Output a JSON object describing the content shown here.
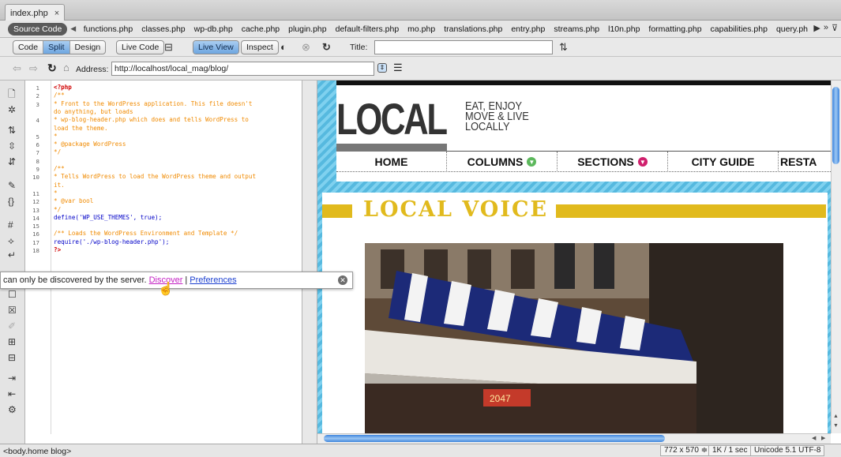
{
  "doc_tab": {
    "label": "index.php",
    "close": "×"
  },
  "related_files": {
    "source_label": "Source Code",
    "files": [
      "functions.php",
      "classes.php",
      "wp-db.php",
      "cache.php",
      "plugin.php",
      "default-filters.php",
      "mo.php",
      "translations.php",
      "entry.php",
      "streams.php",
      "l10n.php",
      "formatting.php",
      "capabilities.php",
      "query.ph"
    ]
  },
  "toolbar": {
    "code": "Code",
    "split": "Split",
    "design": "Design",
    "live_code": "Live Code",
    "live_view": "Live View",
    "inspect": "Inspect",
    "title_label": "Title:",
    "title_value": ""
  },
  "address": {
    "label": "Address:",
    "url": "http://localhost/local_mag/blog/"
  },
  "code_lines": [
    {
      "n": "1",
      "t": "<?php",
      "c": "kw"
    },
    {
      "n": "2",
      "t": "/**",
      "c": "cm"
    },
    {
      "n": "3",
      "t": " * Front to the WordPress application. This file doesn't",
      "c": "cm"
    },
    {
      "n": "",
      "t": "do anything, but loads",
      "c": "cm"
    },
    {
      "n": "4",
      "t": " * wp-blog-header.php which does and tells WordPress to",
      "c": "cm"
    },
    {
      "n": "",
      "t": "load the theme.",
      "c": "cm"
    },
    {
      "n": "5",
      "t": " *",
      "c": "cm"
    },
    {
      "n": "6",
      "t": " * @package WordPress",
      "c": "cm"
    },
    {
      "n": "7",
      "t": " */",
      "c": "cm"
    },
    {
      "n": "8",
      "t": "",
      "c": "cm"
    },
    {
      "n": "9",
      "t": "/**",
      "c": "cm"
    },
    {
      "n": "10",
      "t": " * Tells WordPress to load the WordPress theme and output",
      "c": "cm"
    },
    {
      "n": "",
      "t": "it.",
      "c": "cm"
    },
    {
      "n": "11",
      "t": " *",
      "c": "cm"
    },
    {
      "n": "12",
      "t": " * @var bool",
      "c": "cm"
    },
    {
      "n": "13",
      "t": " */",
      "c": "cm"
    },
    {
      "n": "14",
      "t": "define('WP_USE_THEMES', true);",
      "c": "fn"
    },
    {
      "n": "15",
      "t": "",
      "c": "fn"
    },
    {
      "n": "16",
      "t": "/** Loads the WordPress Environment and Template */",
      "c": "cm"
    },
    {
      "n": "17",
      "t": "require('./wp-blog-header.php');",
      "c": "fn"
    },
    {
      "n": "18",
      "t": "?>",
      "c": "kw"
    }
  ],
  "notification": {
    "text": "can only be discovered by the server.",
    "discover": "Discover",
    "separator": "|",
    "preferences": "Preferences"
  },
  "site": {
    "logo": "LOCAL",
    "tagline": [
      "EAT, ENJOY",
      "MOVE & LIVE",
      "LOCALLY"
    ],
    "nav": [
      "HOME",
      "COLUMNS",
      "SECTIONS",
      "CITY GUIDE",
      "RESTA"
    ],
    "section_title": "LOCAL VOICE",
    "photo_sign": "2047"
  },
  "status": {
    "tag": "<body.home blog>",
    "size": "772 x 570 ≑",
    "download": "1K / 1 sec",
    "encoding": "Unicode 5.1 UTF-8"
  },
  "colors": {
    "accent_yellow": "#e1ba1d",
    "live_blue": "#67c6ea",
    "columns_dot": "#5cb85c",
    "sections_dot": "#d0206d"
  }
}
